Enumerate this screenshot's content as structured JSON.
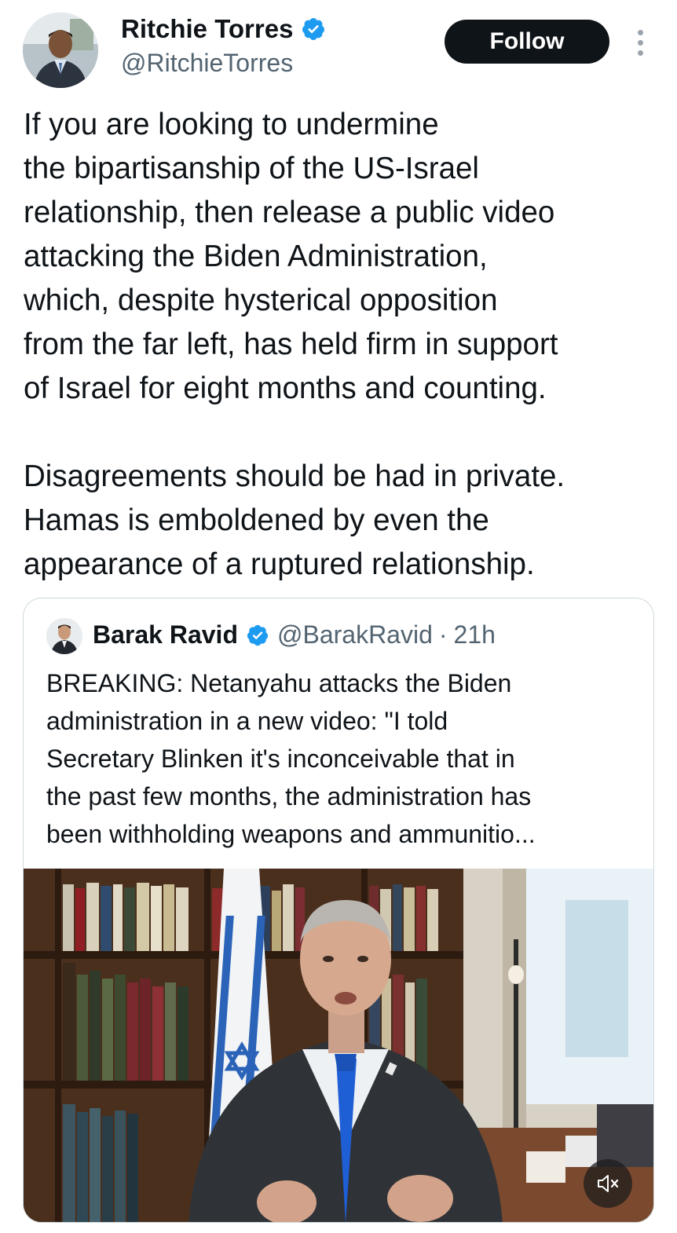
{
  "author": {
    "display_name": "Ritchie Torres",
    "handle": "@RitchieTorres",
    "avatar_icon": "profile-photo",
    "verified": true
  },
  "actions": {
    "follow_label": "Follow",
    "more_icon": "more-vertical-icon"
  },
  "tweet": {
    "lines": [
      "If you are looking to undermine",
      "the bipartisanship of the US-Israel",
      "relationship, then release a public video",
      "attacking the Biden Administration,",
      "which, despite hysterical opposition",
      "from the far left, has held firm in support",
      "of Israel for eight months and counting.",
      "",
      "Disagreements should be had in private.",
      "Hamas is emboldened by even the",
      "appearance of a ruptured relationship."
    ]
  },
  "quote": {
    "display_name": "Barak Ravid",
    "handle": "@BarakRavid",
    "separator": "·",
    "time": "21h",
    "verified": true,
    "lines": [
      "BREAKING: Netanyahu attacks the Biden",
      "administration in a new video: \"I told",
      "Secretary Blinken it's inconceivable that in",
      "the past few months, the administration has",
      "been withholding weapons and ammunitio..."
    ],
    "media": {
      "type": "video",
      "mute_icon": "volume-muted-icon"
    }
  },
  "colors": {
    "text_primary": "#0f1419",
    "text_secondary": "#536471",
    "verified_blue": "#1d9bf0",
    "follow_bg": "#0f1419",
    "border": "#cfd9de"
  }
}
